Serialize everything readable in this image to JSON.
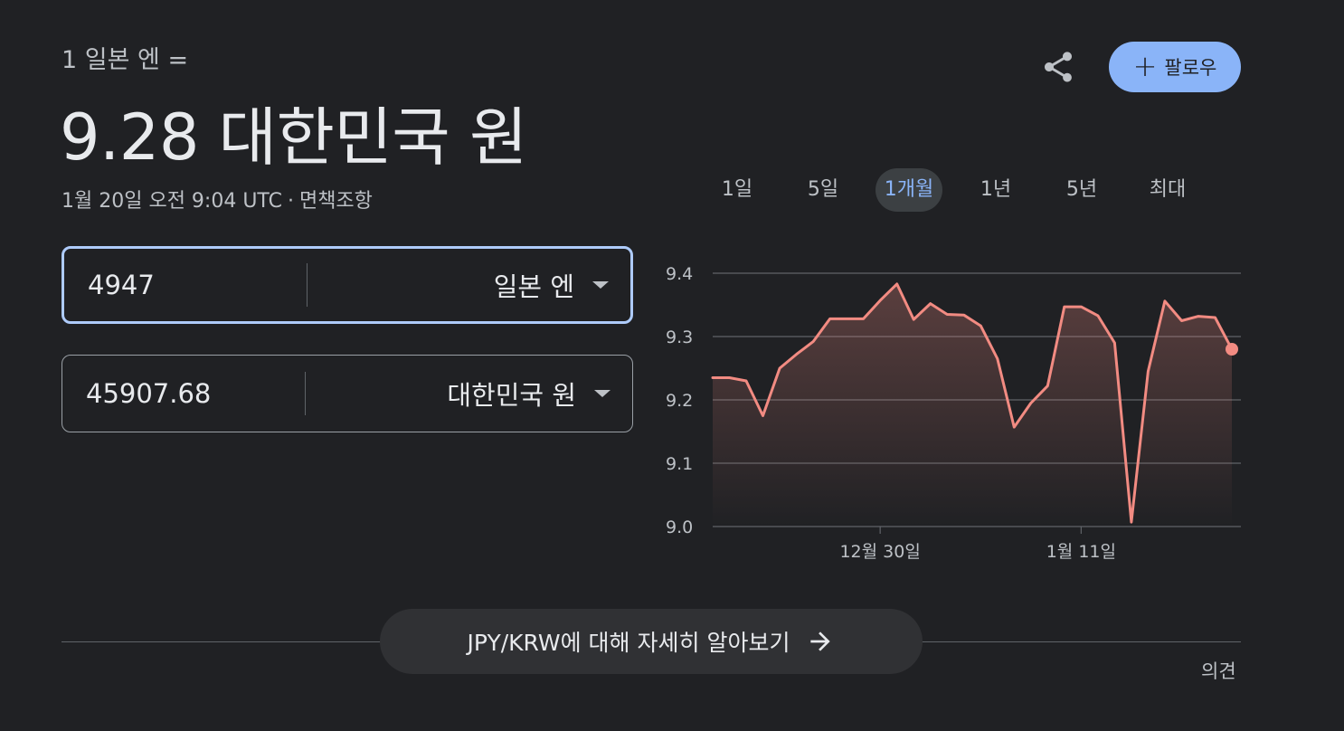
{
  "header": {
    "subtitle": "1 일본 엔 =",
    "headline": "9.28 대한민국 원",
    "timestamp": "1월 20일 오전 9:04 UTC",
    "separator": "·",
    "disclaimer": "면책조항",
    "follow_label": "팔로우",
    "follow_icon": "plus-icon",
    "share_icon": "share-icon"
  },
  "converter": {
    "from": {
      "amount": "4947",
      "currency": "일본 엔"
    },
    "to": {
      "amount": "45907.68",
      "currency": "대한민국 원"
    }
  },
  "range_tabs": {
    "items": [
      "1일",
      "5일",
      "1개월",
      "1년",
      "5년",
      "최대"
    ],
    "active": "1개월"
  },
  "chart_data": {
    "type": "area",
    "ylim": [
      9.0,
      9.4
    ],
    "yticks": [
      "9.4",
      "9.3",
      "9.2",
      "9.1",
      "9.0"
    ],
    "xtick_labels": [
      {
        "label": "12월 30일",
        "index": 10
      },
      {
        "label": "1월 11일",
        "index": 22
      }
    ],
    "values": [
      9.235,
      9.235,
      9.23,
      9.175,
      9.25,
      9.272,
      9.292,
      9.328,
      9.328,
      9.328,
      9.357,
      9.383,
      9.327,
      9.352,
      9.335,
      9.334,
      9.317,
      9.265,
      9.157,
      9.195,
      9.222,
      9.347,
      9.347,
      9.333,
      9.29,
      9.007,
      9.245,
      9.356,
      9.325,
      9.332,
      9.33,
      9.28
    ],
    "line_color": "#f28b82",
    "fill_color": "#f28b82"
  },
  "learn_more": {
    "label": "JPY/KRW에 대해 자세히 알아보기",
    "icon": "arrow-right-icon"
  },
  "feedback": "의견"
}
